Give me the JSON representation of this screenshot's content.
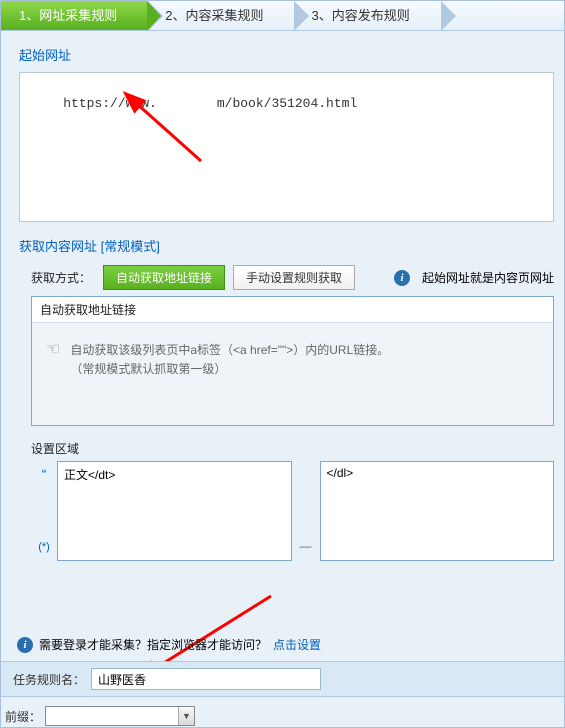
{
  "tabs": {
    "t1": "1、网址采集规则",
    "t2": "2、内容采集规则",
    "t3": "3、内容发布规则"
  },
  "startUrl": {
    "title": "起始网址",
    "prefix": "https://www.",
    "suffix": "m/book/351204.html"
  },
  "contentUrl": {
    "title": "获取内容网址 [常规模式]",
    "fetchLabel": "获取方式：",
    "btnAuto": "自动获取地址链接",
    "btnManual": "手动设置规则获取",
    "note": "起始网址就是内容页网址",
    "autoFrameTitle": "自动获取地址链接",
    "autoDesc1": "自动获取该级列表页中a标签（<a href=\"\">）内的URL链接。",
    "autoDesc2": "（常规模式默认抓取第一级）"
  },
  "settings": {
    "label": "设置区域",
    "markerQuote": "“",
    "markerStar": "(*)",
    "dash": "—",
    "left": "正文</dt>",
    "right": "</dl>"
  },
  "login": {
    "text": "需要登录才能采集？指定浏览器才能访问？",
    "link": "点击设置"
  },
  "taskName": {
    "label": "任务规则名：",
    "value": "山野医香"
  },
  "bottom": {
    "label": "前缀："
  }
}
